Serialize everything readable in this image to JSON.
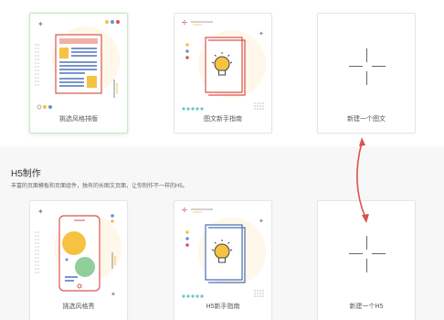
{
  "cards_top": [
    {
      "label": "挑选风格排版"
    },
    {
      "label": "图文新手指南"
    },
    {
      "label": "新建一个图文"
    }
  ],
  "h5_section": {
    "title": "H5制作",
    "description": "丰富的页面模板和页面组件，独有的长图文页面，让你制作不一样的H5。"
  },
  "cards_bottom": [
    {
      "label": "挑选风格秀"
    },
    {
      "label": "H5新手指南"
    },
    {
      "label": "新建一个H5"
    }
  ],
  "colors": {
    "accent_red": "#d9534f",
    "dot_yellow": "#f5c242",
    "dot_teal": "#69c6c1",
    "dot_blue": "#6a8fd9",
    "phone_green": "#8fcf9a"
  }
}
